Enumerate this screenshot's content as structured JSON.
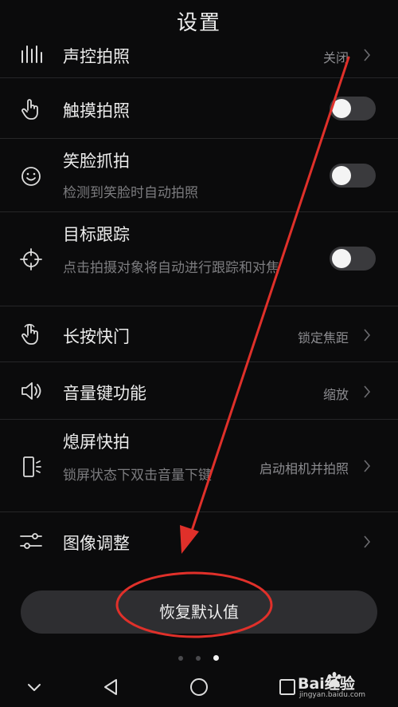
{
  "header": {
    "title": "设置"
  },
  "rows": [
    {
      "label": "声控拍照",
      "value": "关闭",
      "icon": "voice-bars-icon"
    },
    {
      "label": "触摸拍照",
      "toggle": false,
      "icon": "touch-hand-icon"
    },
    {
      "label": "笑脸抓拍",
      "sub": "检测到笑脸时自动拍照",
      "toggle": false,
      "icon": "smile-face-icon"
    },
    {
      "label": "目标跟踪",
      "sub": "点击拍摄对象将自动进行跟踪和对焦",
      "toggle": false,
      "icon": "target-crosshair-icon"
    },
    {
      "label": "长按快门",
      "value": "锁定焦距",
      "icon": "long-press-hand-icon"
    },
    {
      "label": "音量键功能",
      "value": "缩放",
      "icon": "speaker-icon"
    },
    {
      "label": "熄屏快拍",
      "sub": "锁屏状态下双击音量下键",
      "value": "启动相机并拍照",
      "icon": "phone-snap-icon"
    },
    {
      "label": "图像调整",
      "icon": "sliders-icon"
    }
  ],
  "footer": {
    "reset_label": "恢复默认值"
  },
  "pager": {
    "pages": 3,
    "active": 2
  },
  "watermark": {
    "brand": "Bai经验",
    "url": "jingyan.baidu.com"
  },
  "colors": {
    "background": "#0b0b0c",
    "annotation": "#e0302a"
  }
}
